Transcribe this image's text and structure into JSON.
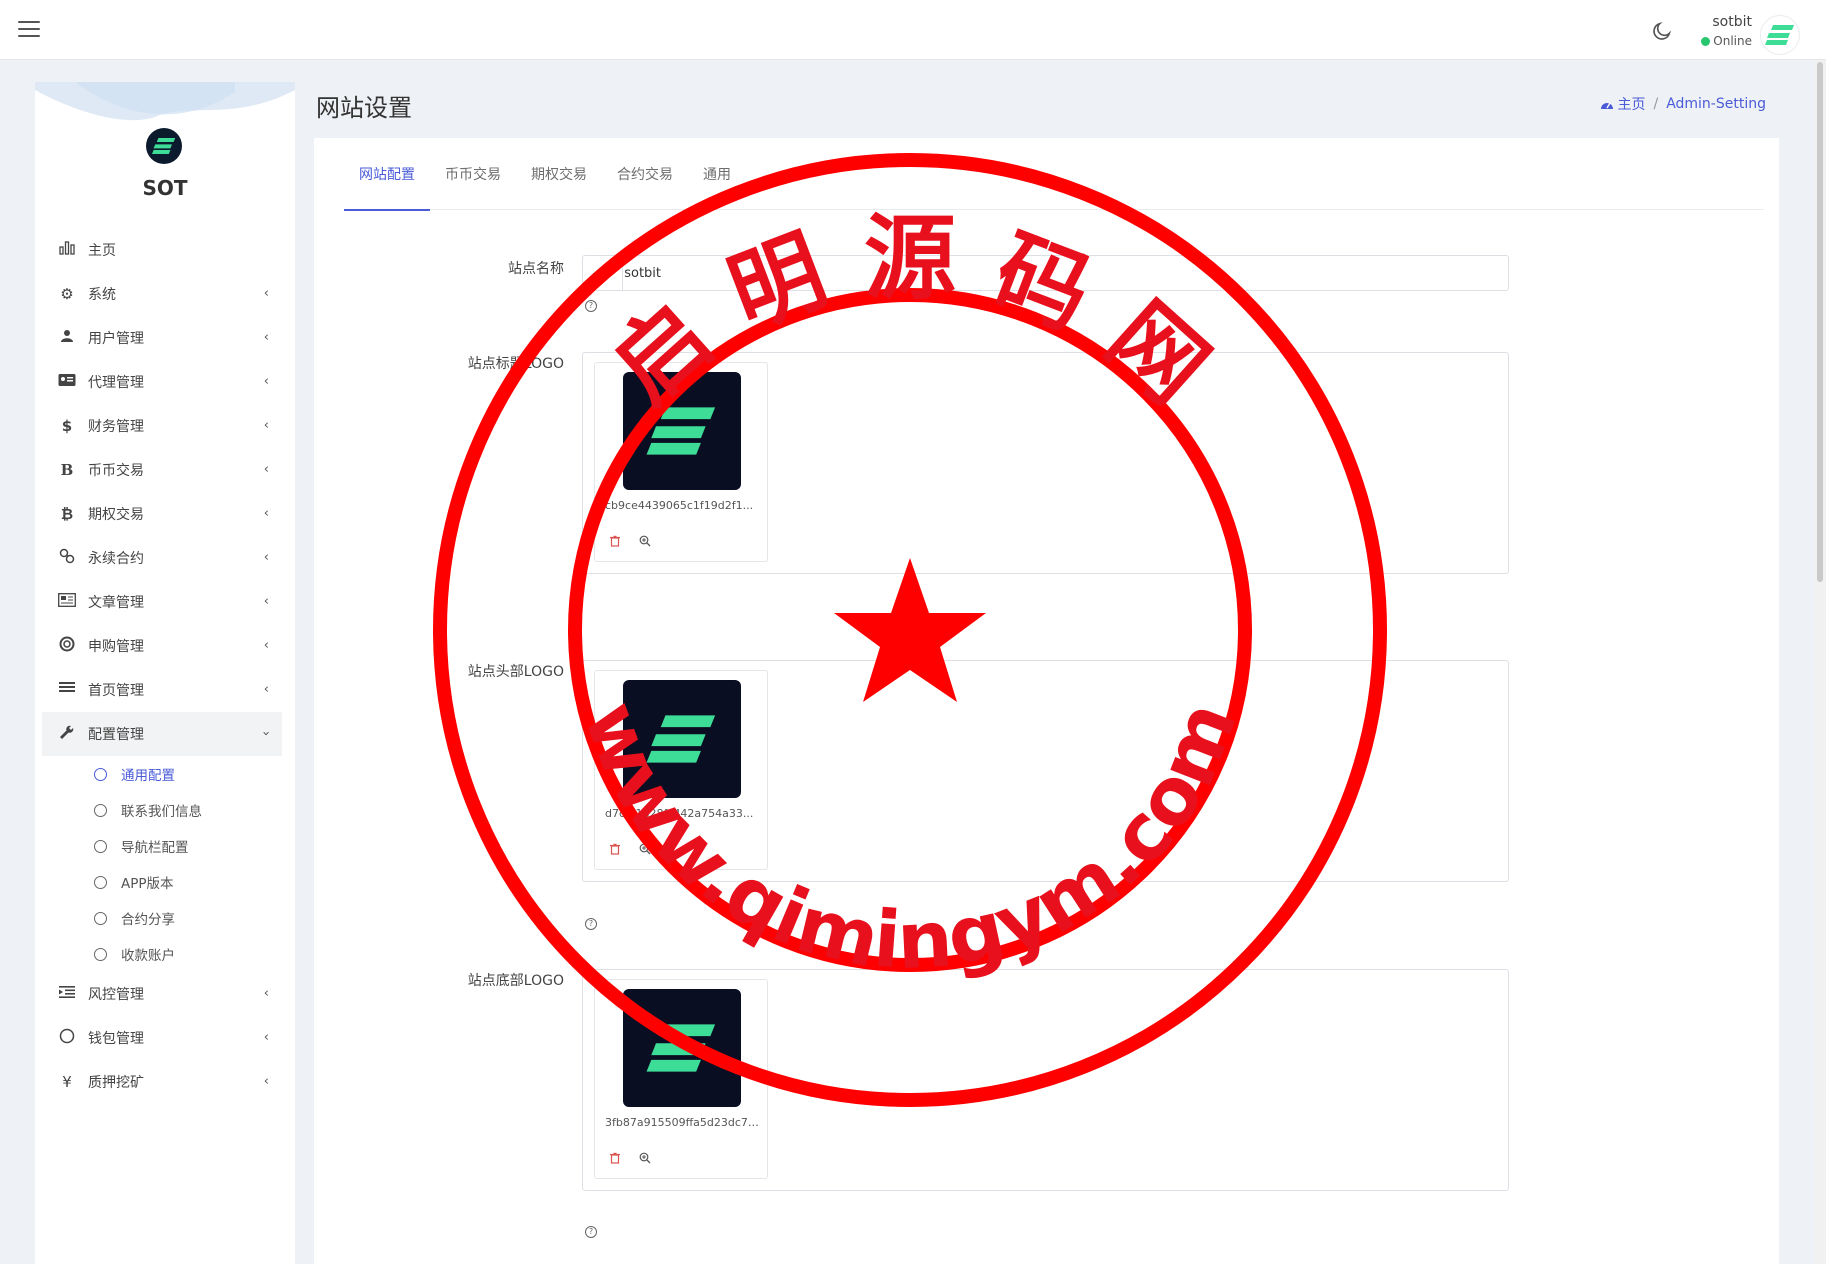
{
  "topbar": {
    "user_name": "sotbit",
    "user_status": "Online"
  },
  "sidebar": {
    "brand": "SOT",
    "items": [
      {
        "label": "主页",
        "icon": "bar-chart-icon",
        "has_children": false
      },
      {
        "label": "系统",
        "icon": "gear-icon",
        "has_children": true
      },
      {
        "label": "用户管理",
        "icon": "users-icon",
        "has_children": true
      },
      {
        "label": "代理管理",
        "icon": "id-card-icon",
        "has_children": true
      },
      {
        "label": "财务管理",
        "icon": "dollar-icon",
        "has_children": true
      },
      {
        "label": "币币交易",
        "icon": "bold-b-icon",
        "has_children": true
      },
      {
        "label": "期权交易",
        "icon": "bitcoin-icon",
        "has_children": true
      },
      {
        "label": "永续合约",
        "icon": "link-icon",
        "has_children": true
      },
      {
        "label": "文章管理",
        "icon": "newspaper-icon",
        "has_children": true
      },
      {
        "label": "申购管理",
        "icon": "life-ring-icon",
        "has_children": true
      },
      {
        "label": "首页管理",
        "icon": "list-icon",
        "has_children": true
      },
      {
        "label": "配置管理",
        "icon": "wrench-icon",
        "has_children": true,
        "open": true
      }
    ],
    "sub_items": [
      {
        "label": "通用配置",
        "active": true
      },
      {
        "label": "联系我们信息",
        "active": false
      },
      {
        "label": "导航栏配置",
        "active": false
      },
      {
        "label": "APP版本",
        "active": false
      },
      {
        "label": "合约分享",
        "active": false
      },
      {
        "label": "收款账户",
        "active": false
      }
    ],
    "items_after": [
      {
        "label": "风控管理",
        "icon": "indent-icon",
        "has_children": true
      },
      {
        "label": "钱包管理",
        "icon": "circle-icon",
        "has_children": true
      },
      {
        "label": "质押挖矿",
        "icon": "yen-icon",
        "has_children": true
      }
    ]
  },
  "header": {
    "title": "网站设置",
    "breadcrumb_home": "主页",
    "breadcrumb_current": "Admin-Setting"
  },
  "tabs": [
    "网站配置",
    "币币交易",
    "期权交易",
    "合约交易",
    "通用"
  ],
  "form": {
    "site_name_label": "站点名称",
    "site_name_value": "sotbit",
    "logo_fields": [
      {
        "label": "站点标题LOGO",
        "filename": "cb9ce4439065c1f19d2f1..."
      },
      {
        "label": "站点头部LOGO",
        "filename": "d7c.91628fc442a754a33..."
      },
      {
        "label": "站点底部LOGO",
        "filename": "3fb87a915509ffa5d23dc73..."
      }
    ]
  },
  "watermark": {
    "top_text": "启 明 源 码 网",
    "bottom_text": "www.qimingym.com",
    "color": "#ff0000"
  },
  "colors": {
    "accent": "#4a5bd8",
    "logo_bg": "#0a0e23",
    "logo_green": "#3ddc97",
    "online": "#28c76f"
  }
}
